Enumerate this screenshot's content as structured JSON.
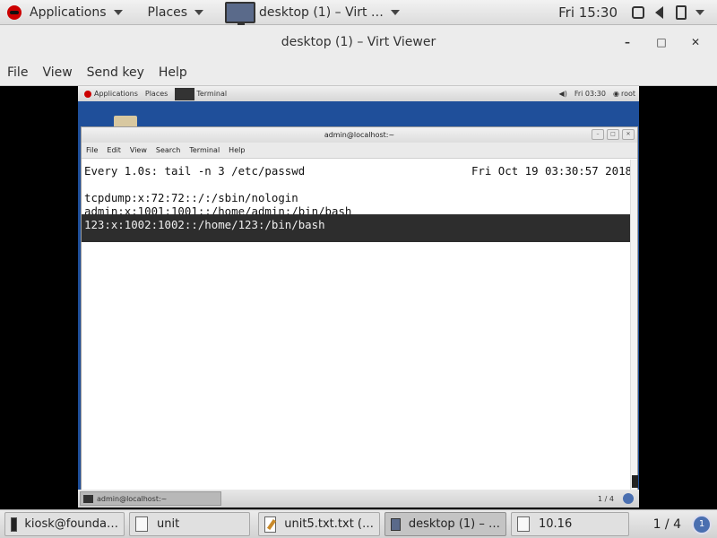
{
  "host_top_panel": {
    "applications": "Applications",
    "places": "Places",
    "window_title": "desktop (1) – Virt …",
    "clock": "Fri 15:30"
  },
  "viewer_window": {
    "title": "desktop (1) – Virt Viewer",
    "menu": [
      "File",
      "View",
      "Send key",
      "Help"
    ]
  },
  "guest_top_panel": {
    "applications": "Applications",
    "places": "Places",
    "terminal": "Terminal",
    "clock": "Fri 03:30",
    "user": "root"
  },
  "terminal": {
    "title": "admin@localhost:~",
    "menu": [
      "File",
      "Edit",
      "View",
      "Search",
      "Terminal",
      "Help"
    ],
    "header_command": "Every 1.0s: tail -n 3 /etc/passwd",
    "header_date": "Fri Oct 19 03:30:57 2018",
    "lines": [
      "tcpdump:x:72:72::/:/sbin/nologin",
      "admin:x:1001:1001::/home/admin:/bin/bash",
      "123:x:1002:1002::/home/123:/bin/bash"
    ]
  },
  "guest_bottom_panel": {
    "task": "admin@localhost:~",
    "pager": "1 / 4"
  },
  "host_taskbar": {
    "tasks": [
      "kiosk@founda…",
      "unit",
      "unit5.txt.txt (…",
      "desktop (1) – …",
      "10.16"
    ],
    "pager": "1 / 4"
  }
}
